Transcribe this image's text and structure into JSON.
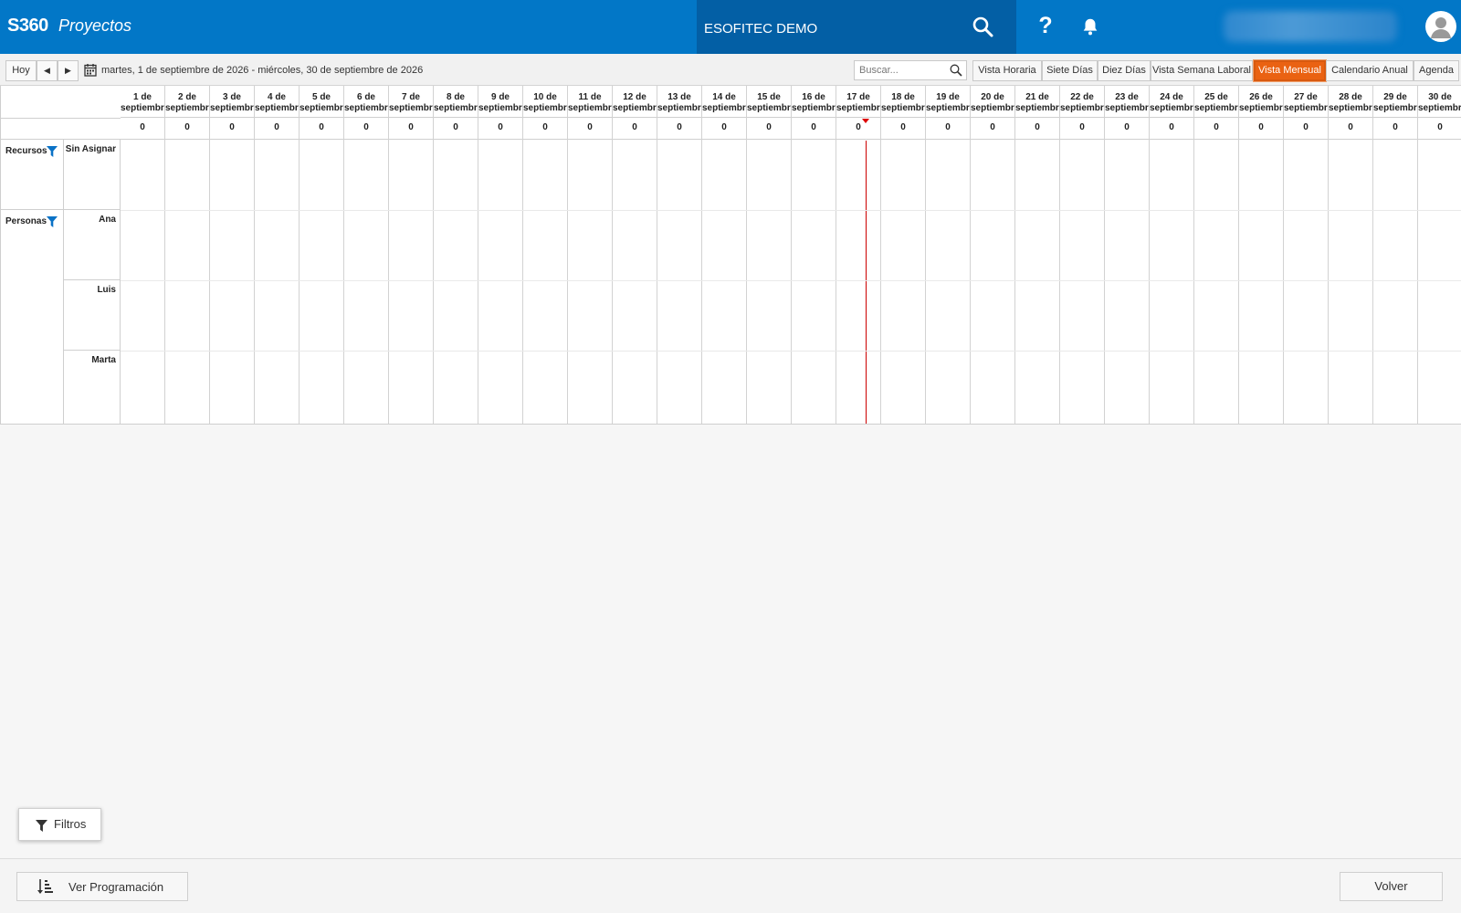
{
  "app": {
    "logo": "S360",
    "module": "Proyectos",
    "company": "ESOFITEC DEMO",
    "help_label": "?"
  },
  "toolbar": {
    "today_label": "Hoy",
    "prev_label": "◀",
    "next_label": "▶",
    "date_range": "martes, 1 de septiembre de 2026 - miércoles, 30 de septiembre de 2026",
    "search_placeholder": "Buscar..."
  },
  "views": [
    {
      "label": "Vista Horaria",
      "active": false
    },
    {
      "label": "Siete Días",
      "active": false
    },
    {
      "label": "Diez Días",
      "active": false
    },
    {
      "label": "Vista Semana Laboral",
      "active": false
    },
    {
      "label": "Vista Mensual",
      "active": true
    },
    {
      "label": "Calendario Anual",
      "active": false
    },
    {
      "label": "Agenda",
      "active": false
    }
  ],
  "groups": [
    {
      "label": "Recursos",
      "rows": [
        "Sin Asignar"
      ]
    },
    {
      "label": "Personas",
      "rows": [
        "Ana",
        "Luis",
        "Marta"
      ]
    }
  ],
  "days": [
    {
      "day": "1 de",
      "month": "septiembre",
      "count": "0"
    },
    {
      "day": "2 de",
      "month": "septiembre",
      "count": "0"
    },
    {
      "day": "3 de",
      "month": "septiembre",
      "count": "0"
    },
    {
      "day": "4 de",
      "month": "septiembre",
      "count": "0"
    },
    {
      "day": "5 de",
      "month": "septiembre",
      "count": "0"
    },
    {
      "day": "6 de",
      "month": "septiembre",
      "count": "0"
    },
    {
      "day": "7 de",
      "month": "septiembre",
      "count": "0"
    },
    {
      "day": "8 de",
      "month": "septiembre",
      "count": "0"
    },
    {
      "day": "9 de",
      "month": "septiembre",
      "count": "0"
    },
    {
      "day": "10 de",
      "month": "septiembre",
      "count": "0"
    },
    {
      "day": "11 de",
      "month": "septiembre",
      "count": "0"
    },
    {
      "day": "12 de",
      "month": "septiembre",
      "count": "0"
    },
    {
      "day": "13 de",
      "month": "septiembre",
      "count": "0"
    },
    {
      "day": "14 de",
      "month": "septiembre",
      "count": "0"
    },
    {
      "day": "15 de",
      "month": "septiembre",
      "count": "0"
    },
    {
      "day": "16 de",
      "month": "septiembre",
      "count": "0"
    },
    {
      "day": "17 de",
      "month": "septiembre",
      "count": "0"
    },
    {
      "day": "18 de",
      "month": "septiembre",
      "count": "0"
    },
    {
      "day": "19 de",
      "month": "septiembre",
      "count": "0"
    },
    {
      "day": "20 de",
      "month": "septiembre",
      "count": "0"
    },
    {
      "day": "21 de",
      "month": "septiembre",
      "count": "0"
    },
    {
      "day": "22 de",
      "month": "septiembre",
      "count": "0"
    },
    {
      "day": "23 de",
      "month": "septiembre",
      "count": "0"
    },
    {
      "day": "24 de",
      "month": "septiembre",
      "count": "0"
    },
    {
      "day": "25 de",
      "month": "septiembre",
      "count": "0"
    },
    {
      "day": "26 de",
      "month": "septiembre",
      "count": "0"
    },
    {
      "day": "27 de",
      "month": "septiembre",
      "count": "0"
    },
    {
      "day": "28 de",
      "month": "septiembre",
      "count": "0"
    },
    {
      "day": "29 de",
      "month": "septiembre",
      "count": "0"
    },
    {
      "day": "30 de",
      "month": "septiembre",
      "count": "0"
    }
  ],
  "today_index": 16,
  "filters_label": "Filtros",
  "footer": {
    "schedule_label": "Ver Programación",
    "back_label": "Volver"
  },
  "colors": {
    "header": "#0277c7",
    "company_bg": "#035fa5",
    "active_view": "#ea6212",
    "today_line": "#cc0000"
  },
  "icons": [
    "search-icon",
    "help-icon",
    "bell-icon",
    "user-icon",
    "calendar-icon",
    "filter-icon",
    "sort-icon"
  ]
}
